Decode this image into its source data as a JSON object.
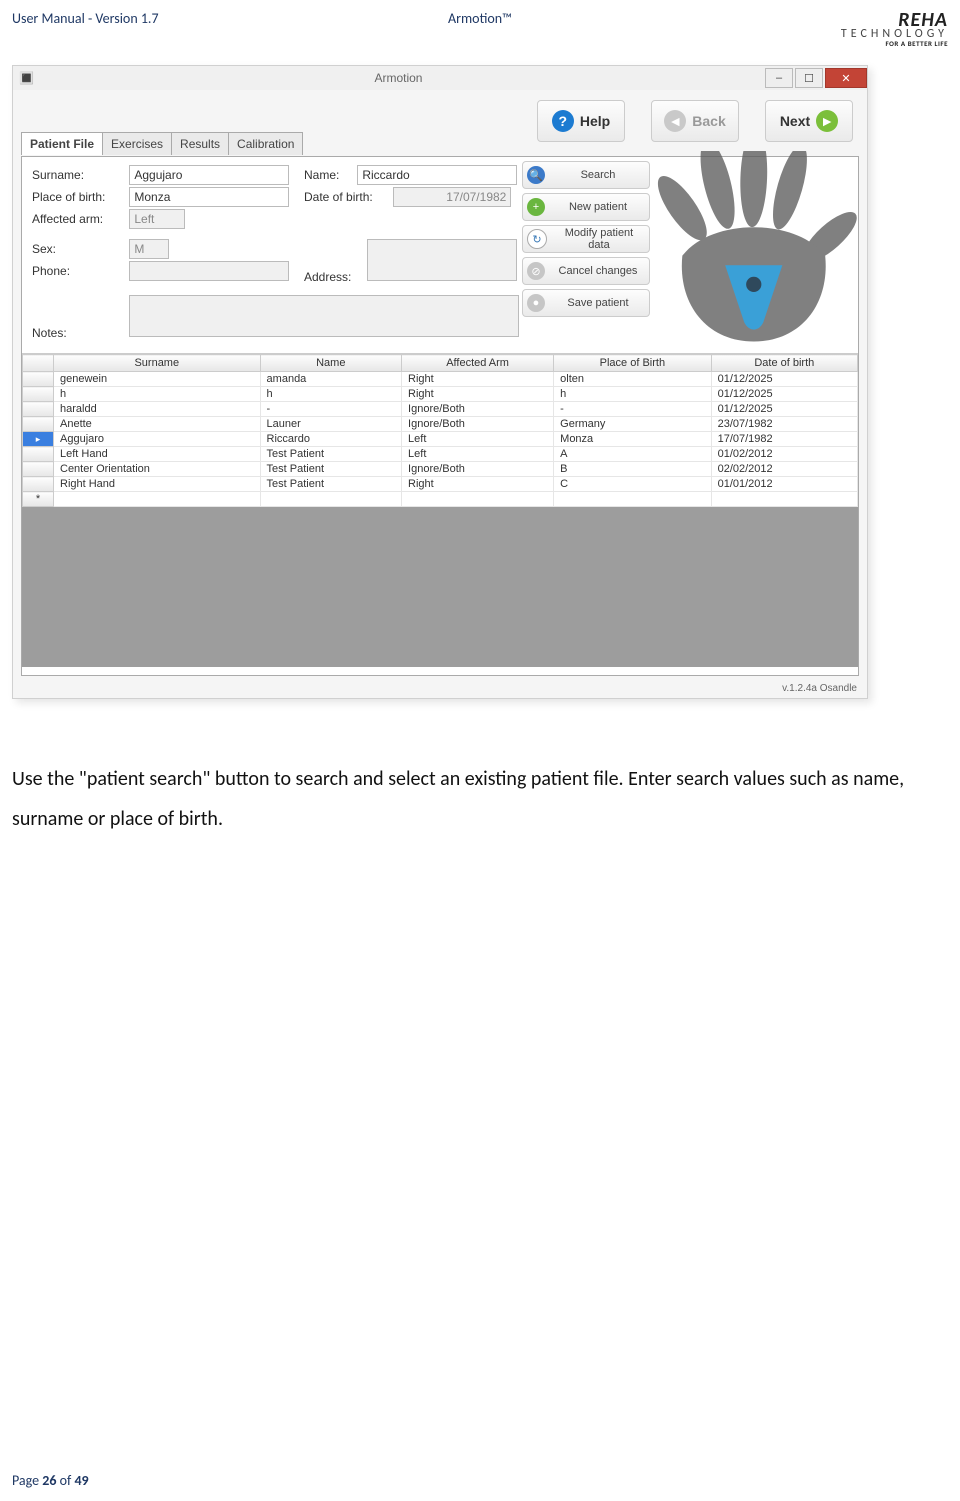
{
  "doc": {
    "header_left": "User Manual - Version 1.7",
    "header_center": "Armotion™",
    "logo_l1": "REHA",
    "logo_l2": "TECHNOLOGY",
    "logo_l3": "FOR A BETTER LIFE",
    "body_text": "Use the \"patient search\" button to search and select an existing patient file. Enter search values such as name, surname or place of birth.",
    "footer_prefix": "Page ",
    "footer_page": "26",
    "footer_mid": " of ",
    "footer_total": "49"
  },
  "app": {
    "title": "Armotion",
    "help": "Help",
    "back": "Back",
    "next": "Next",
    "version": "v.1.2.4a   Osandle",
    "tabs": [
      "Patient File",
      "Exercises",
      "Results",
      "Calibration"
    ],
    "labels": {
      "surname": "Surname:",
      "name": "Name:",
      "pob": "Place of birth:",
      "dob": "Date of birth:",
      "arm": "Affected arm:",
      "sex": "Sex:",
      "address": "Address:",
      "phone": "Phone:",
      "notes": "Notes:"
    },
    "values": {
      "surname": "Aggujaro",
      "name": "Riccardo",
      "pob": "Monza",
      "dob": "17/07/1982",
      "arm": "Left",
      "sex": "M"
    },
    "actions": {
      "search": "Search",
      "new": "New patient",
      "modify": "Modify patient data",
      "cancel": "Cancel changes",
      "save": "Save patient"
    },
    "grid": {
      "headers": [
        "Surname",
        "Name",
        "Affected Arm",
        "Place of Birth",
        "Date of birth"
      ],
      "rows": [
        {
          "sel": false,
          "c": [
            "genewein",
            "amanda",
            "Right",
            "olten",
            "01/12/2025"
          ]
        },
        {
          "sel": false,
          "c": [
            "h",
            "h",
            "Right",
            "h",
            "01/12/2025"
          ]
        },
        {
          "sel": false,
          "c": [
            "haraldd",
            "-",
            "Ignore/Both",
            "-",
            "01/12/2025"
          ]
        },
        {
          "sel": false,
          "c": [
            "Anette",
            "Launer",
            "Ignore/Both",
            "Germany",
            "23/07/1982"
          ]
        },
        {
          "sel": true,
          "c": [
            "Aggujaro",
            "Riccardo",
            "Left",
            "Monza",
            "17/07/1982"
          ]
        },
        {
          "sel": false,
          "c": [
            "Left Hand",
            "Test Patient",
            "Left",
            "A",
            "01/02/2012"
          ]
        },
        {
          "sel": false,
          "c": [
            "Center Orientation",
            "Test Patient",
            "Ignore/Both",
            "B",
            "02/02/2012"
          ]
        },
        {
          "sel": false,
          "c": [
            "Right Hand",
            "Test Patient",
            "Right",
            "C",
            "01/01/2012"
          ]
        }
      ]
    }
  }
}
